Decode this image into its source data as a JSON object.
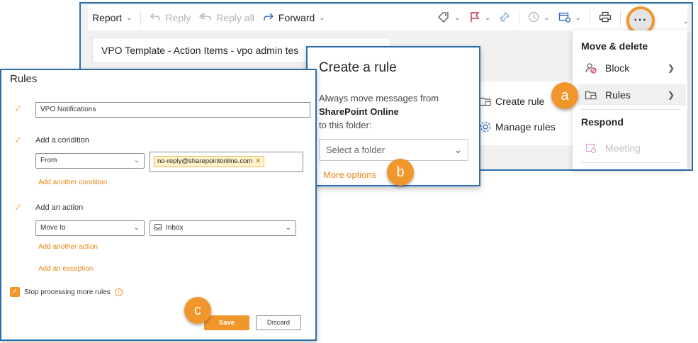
{
  "toolbar": {
    "report": "Report",
    "reply": "Reply",
    "reply_all": "Reply all",
    "forward": "Forward",
    "more": "···"
  },
  "message": {
    "subject": "VPO Template - Action Items - vpo admin tes"
  },
  "context_list": {
    "create_rule": "Create rule",
    "manage_rules": "Manage rules"
  },
  "menu": {
    "section_move": "Move & delete",
    "block": "Block",
    "rules": "Rules",
    "section_respond": "Respond",
    "meeting": "Meeting"
  },
  "create_rule": {
    "title": "Create a rule",
    "desc_1": "Always move messages from",
    "sender": "SharePoint Online",
    "desc_2": "to this folder:",
    "folder_placeholder": "Select a folder",
    "more_options": "More options"
  },
  "rules_panel": {
    "title": "Rules",
    "rule_name": "VPO Notifications",
    "add_condition": "Add a condition",
    "condition_field": "From",
    "condition_value": "no-reply@sharepointonline.com",
    "add_another_condition": "Add another condition",
    "add_action": "Add an action",
    "action_field": "Move to",
    "action_value": "Inbox",
    "add_another_action": "Add another action",
    "add_exception": "Add an exception",
    "stop_processing": "Stop processing more rules",
    "save": "Save",
    "discard": "Discard"
  },
  "callouts": {
    "a": "a",
    "b": "b",
    "c": "c"
  },
  "colors": {
    "accent": "#f0962a",
    "frame": "#2e6fab",
    "link": "#e8891a"
  }
}
